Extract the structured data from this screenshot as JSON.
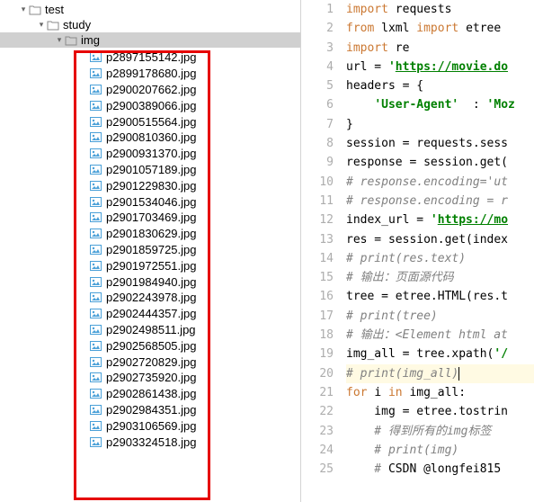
{
  "tree": {
    "root": "test",
    "child": "study",
    "selected": "img"
  },
  "files": [
    "p2897155142.jpg",
    "p2899178680.jpg",
    "p2900207662.jpg",
    "p2900389066.jpg",
    "p2900515564.jpg",
    "p2900810360.jpg",
    "p2900931370.jpg",
    "p2901057189.jpg",
    "p2901229830.jpg",
    "p2901534046.jpg",
    "p2901703469.jpg",
    "p2901830629.jpg",
    "p2901859725.jpg",
    "p2901972551.jpg",
    "p2901984940.jpg",
    "p2902243978.jpg",
    "p2902444357.jpg",
    "p2902498511.jpg",
    "p2902568505.jpg",
    "p2902720829.jpg",
    "p2902735920.jpg",
    "p2902861438.jpg",
    "p2902984351.jpg",
    "p2903106569.jpg",
    "p2903324518.jpg"
  ],
  "code": {
    "lines": [
      {
        "n": 1,
        "seg": [
          {
            "c": "kw",
            "t": "import "
          },
          {
            "c": "ident",
            "t": "requests"
          }
        ]
      },
      {
        "n": 2,
        "seg": [
          {
            "c": "kw",
            "t": "from "
          },
          {
            "c": "ident",
            "t": "lxml "
          },
          {
            "c": "kw",
            "t": "import "
          },
          {
            "c": "ident",
            "t": "etree"
          }
        ]
      },
      {
        "n": 3,
        "seg": [
          {
            "c": "kw",
            "t": "import "
          },
          {
            "c": "ident",
            "t": "re"
          }
        ]
      },
      {
        "n": 4,
        "seg": [
          {
            "c": "ident",
            "t": "url = "
          },
          {
            "c": "str",
            "t": "'"
          },
          {
            "c": "strlink",
            "t": "https://movie.do"
          }
        ]
      },
      {
        "n": 5,
        "seg": [
          {
            "c": "ident",
            "t": "headers = {"
          }
        ]
      },
      {
        "n": 6,
        "seg": [
          {
            "c": "ident",
            "t": "    "
          },
          {
            "c": "str",
            "t": "'User-Agent'"
          },
          {
            "c": "ident",
            "t": "  : "
          },
          {
            "c": "str",
            "t": "'Moz"
          }
        ]
      },
      {
        "n": 7,
        "seg": [
          {
            "c": "ident",
            "t": "}"
          }
        ]
      },
      {
        "n": 8,
        "seg": [
          {
            "c": "ident",
            "t": "session = requests.sess"
          }
        ]
      },
      {
        "n": 9,
        "seg": [
          {
            "c": "ident",
            "t": "response = session.get("
          }
        ]
      },
      {
        "n": 10,
        "seg": [
          {
            "c": "comment",
            "t": "# response.encoding='ut"
          }
        ]
      },
      {
        "n": 11,
        "seg": [
          {
            "c": "comment",
            "t": "# response.encoding = r"
          }
        ]
      },
      {
        "n": 12,
        "seg": [
          {
            "c": "ident",
            "t": "index_url = "
          },
          {
            "c": "str",
            "t": "'"
          },
          {
            "c": "strlink",
            "t": "https://mo"
          }
        ]
      },
      {
        "n": 13,
        "seg": [
          {
            "c": "ident",
            "t": "res = session.get(index"
          }
        ]
      },
      {
        "n": 14,
        "seg": [
          {
            "c": "comment",
            "t": "# print(res.text)"
          }
        ]
      },
      {
        "n": 15,
        "seg": [
          {
            "c": "comment",
            "t": "# 输出：页面源代码"
          }
        ]
      },
      {
        "n": 16,
        "seg": [
          {
            "c": "ident",
            "t": "tree = etree.HTML(res.t"
          }
        ]
      },
      {
        "n": 17,
        "seg": [
          {
            "c": "comment",
            "t": "# print(tree)"
          }
        ]
      },
      {
        "n": 18,
        "seg": [
          {
            "c": "comment",
            "t": "# 输出：<Element html at"
          }
        ]
      },
      {
        "n": 19,
        "seg": [
          {
            "c": "ident",
            "t": "img_all = tree.xpath("
          },
          {
            "c": "str",
            "t": "'/"
          }
        ]
      },
      {
        "n": 20,
        "hl": true,
        "seg": [
          {
            "c": "comment",
            "t": "# print(img_all)"
          },
          {
            "c": "cursor",
            "t": ""
          }
        ]
      },
      {
        "n": 21,
        "seg": [
          {
            "c": "kw",
            "t": "for "
          },
          {
            "c": "ident",
            "t": "i "
          },
          {
            "c": "kw",
            "t": "in "
          },
          {
            "c": "ident",
            "t": "img_all:"
          }
        ]
      },
      {
        "n": 22,
        "seg": [
          {
            "c": "ident",
            "t": "    img = etree.tostrin"
          }
        ]
      },
      {
        "n": 23,
        "seg": [
          {
            "c": "comment",
            "t": "    # 得到所有的img标签"
          }
        ]
      },
      {
        "n": 24,
        "seg": [
          {
            "c": "comment",
            "t": "    # print(img)"
          }
        ]
      },
      {
        "n": 25,
        "seg": [
          {
            "c": "comment",
            "t": "    # "
          },
          {
            "c": "ident",
            "t": "CSDN @longfei815"
          }
        ]
      }
    ]
  }
}
